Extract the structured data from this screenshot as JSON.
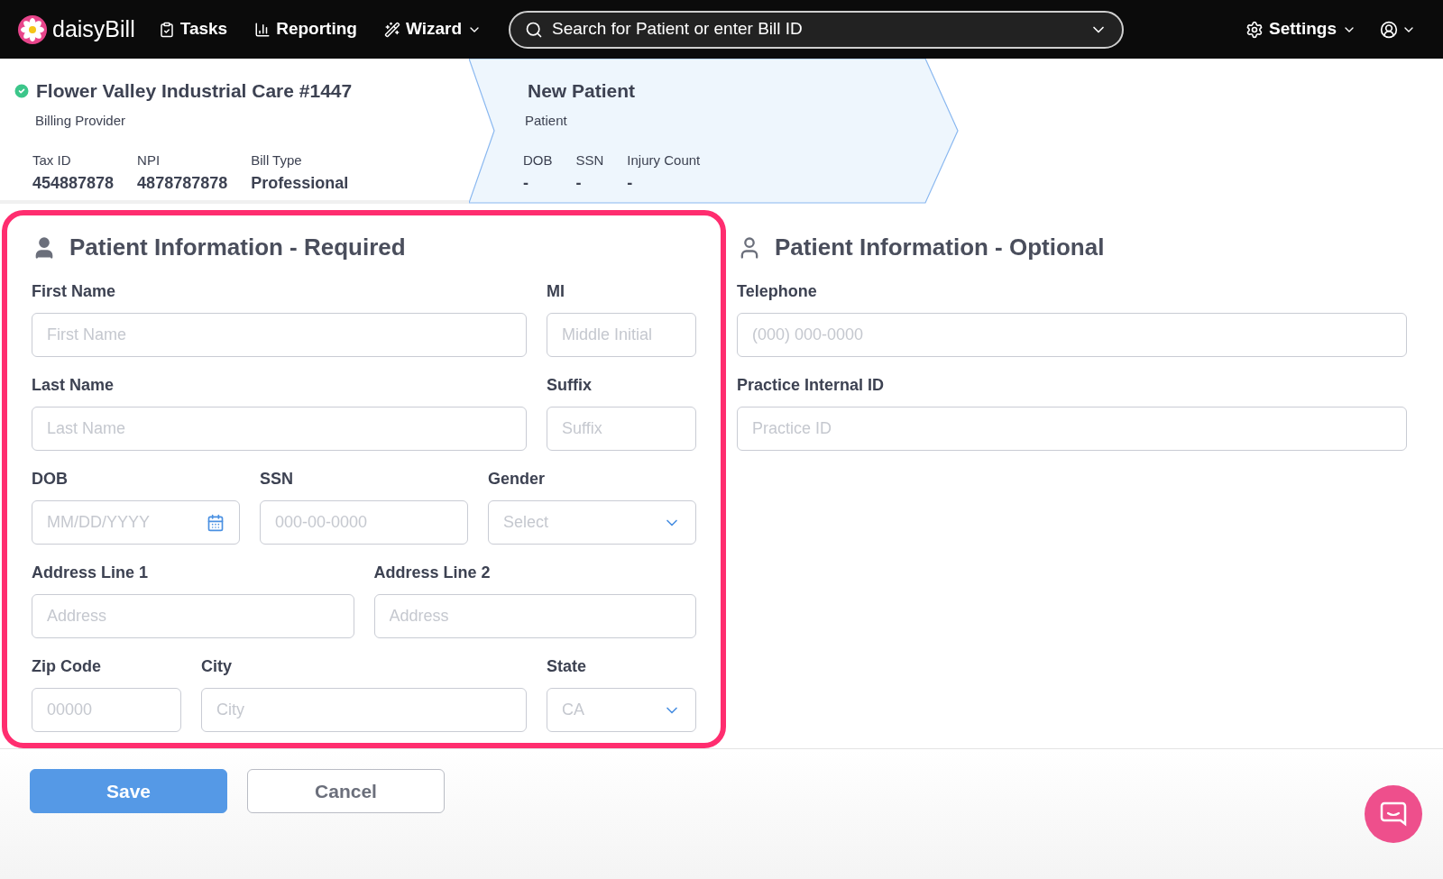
{
  "nav": {
    "logo": "daisyBill",
    "items": [
      {
        "label": "Tasks",
        "kind": "tasks",
        "dropdown": false
      },
      {
        "label": "Reporting",
        "kind": "reporting",
        "dropdown": false
      },
      {
        "label": "Wizard",
        "kind": "wizard",
        "dropdown": true
      }
    ],
    "search": {
      "placeholder": "Search for Patient or enter Bill ID"
    },
    "settings": "Settings"
  },
  "provider": {
    "name": "Flower Valley Industrial Care #1447",
    "verified": true,
    "role": "Billing Provider",
    "fields": [
      {
        "label": "Tax ID",
        "value": "454887878"
      },
      {
        "label": "NPI",
        "value": "4878787878"
      },
      {
        "label": "Bill Type",
        "value": "Professional"
      }
    ]
  },
  "patient": {
    "name": "New Patient",
    "role": "Patient",
    "fields": [
      {
        "label": "DOB",
        "value": "-"
      },
      {
        "label": "SSN",
        "value": "-"
      },
      {
        "label": "Injury Count",
        "value": "-"
      }
    ]
  },
  "required": {
    "title": "Patient Information - Required",
    "rows": [
      [
        {
          "label": "First Name",
          "placeholder": "First Name",
          "kind": "text"
        },
        {
          "label": "MI",
          "placeholder": "Middle Initial",
          "kind": "text"
        }
      ],
      [
        {
          "label": "Last Name",
          "placeholder": "Last Name",
          "kind": "text"
        },
        {
          "label": "Suffix",
          "placeholder": "Suffix",
          "kind": "text"
        }
      ],
      [
        {
          "label": "DOB",
          "placeholder": "MM/DD/YYYY",
          "kind": "date"
        },
        {
          "label": "SSN",
          "placeholder": "000-00-0000",
          "kind": "text"
        },
        {
          "label": "Gender",
          "placeholder": "Select",
          "kind": "select"
        }
      ],
      [
        {
          "label": "Address Line 1",
          "placeholder": "Address",
          "kind": "text"
        },
        {
          "label": "Address Line 2",
          "placeholder": "Address",
          "kind": "text"
        }
      ],
      [
        {
          "label": "Zip Code",
          "placeholder": "00000",
          "kind": "text"
        },
        {
          "label": "City",
          "placeholder": "City",
          "kind": "text"
        },
        {
          "label": "State",
          "placeholder": "CA",
          "kind": "select"
        }
      ]
    ]
  },
  "optional": {
    "title": "Patient Information - Optional",
    "rows": [
      [
        {
          "label": "Telephone",
          "placeholder": "(000) 000-0000",
          "kind": "text"
        }
      ],
      [
        {
          "label": "Practice Internal ID",
          "placeholder": "Practice ID",
          "kind": "text"
        }
      ]
    ]
  },
  "buttons": [
    {
      "label": "Save",
      "kind": "primary"
    },
    {
      "label": "Cancel",
      "kind": "secondary"
    }
  ]
}
